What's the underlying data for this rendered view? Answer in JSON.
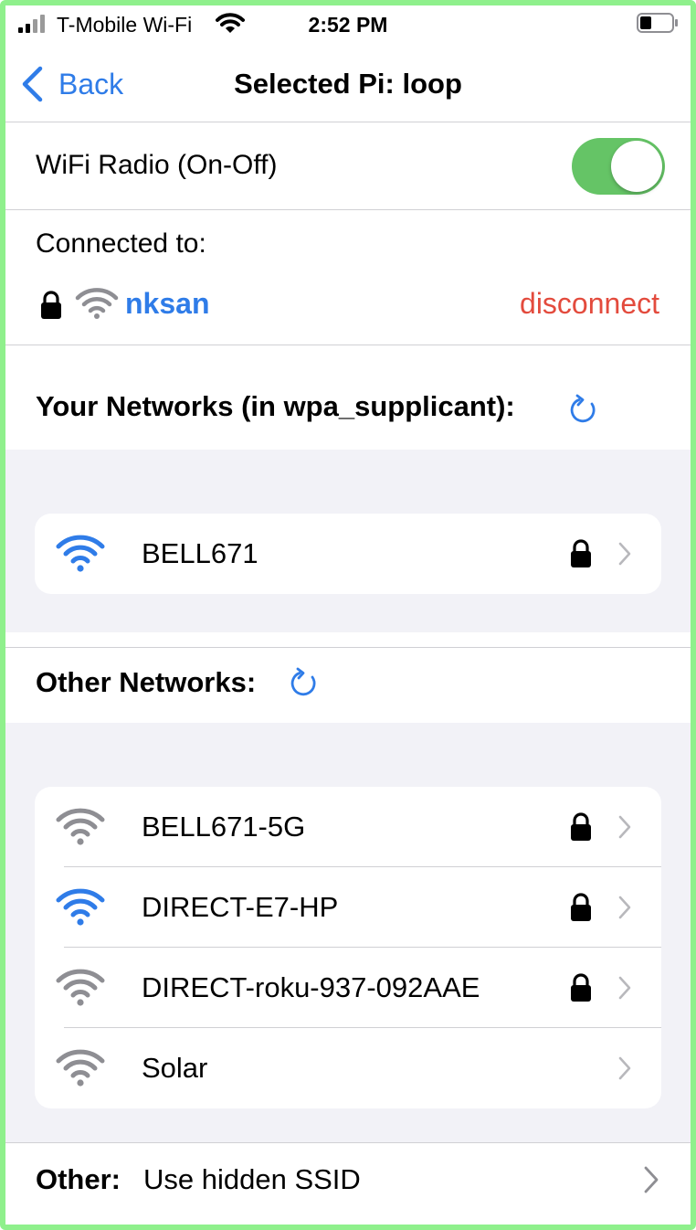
{
  "status_bar": {
    "carrier": "T-Mobile Wi-Fi",
    "time": "2:52 PM"
  },
  "nav": {
    "back_label": "Back",
    "title": "Selected Pi: loop"
  },
  "wifi_radio": {
    "label": "WiFi Radio (On-Off)",
    "enabled": true
  },
  "connection": {
    "label": "Connected to:",
    "ssid": "nksan",
    "disconnect_label": "disconnect"
  },
  "your_networks": {
    "title": "Your Networks (in wpa_supplicant):",
    "items": [
      {
        "name": "BELL671",
        "locked": true,
        "signal_color": "#2f7ce8"
      }
    ]
  },
  "other_networks": {
    "title": "Other Networks:",
    "items": [
      {
        "name": "BELL671-5G",
        "locked": true,
        "signal_color": "#8e8e93"
      },
      {
        "name": "DIRECT-E7-HP",
        "locked": true,
        "signal_color": "#2f7ce8"
      },
      {
        "name": "DIRECT-roku-937-092AAE",
        "locked": true,
        "signal_color": "#8e8e93"
      },
      {
        "name": "Solar",
        "locked": false,
        "signal_color": "#8e8e93"
      }
    ]
  },
  "hidden_ssid": {
    "key": "Other:",
    "value": "Use hidden SSID"
  },
  "colors": {
    "accent": "#2f7ce8",
    "destructive": "#e34b3d",
    "toggle_on": "#65c466",
    "group_bg": "#f2f2f7"
  }
}
